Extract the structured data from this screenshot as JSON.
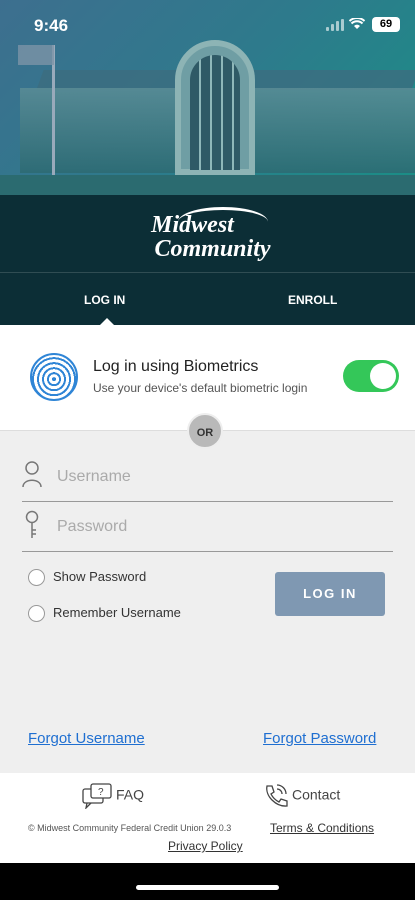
{
  "status_bar": {
    "time": "9:46",
    "battery": "69"
  },
  "brand": {
    "line1": "Midwest",
    "line2": "Community"
  },
  "tabs": {
    "login": "LOG IN",
    "enroll": "ENROLL"
  },
  "biometrics": {
    "title": "Log in using Biometrics",
    "subtitle": "Use your device's default biometric login",
    "enabled": true
  },
  "or_label": "OR",
  "form": {
    "username_placeholder": "Username",
    "password_placeholder": "Password",
    "show_password": "Show Password",
    "remember_username": "Remember Username",
    "login_button": "LOG IN"
  },
  "links": {
    "forgot_username": "Forgot Username",
    "forgot_password": "Forgot Password"
  },
  "footer": {
    "faq": "FAQ",
    "contact": "Contact",
    "copyright": "© Midwest Community Federal Credit Union 29.0.3",
    "terms": "Terms & Conditions",
    "privacy": "Privacy Policy"
  },
  "colors": {
    "toggle_on": "#34c759",
    "login_button": "#7f98b2",
    "link": "#1f6fd1"
  }
}
